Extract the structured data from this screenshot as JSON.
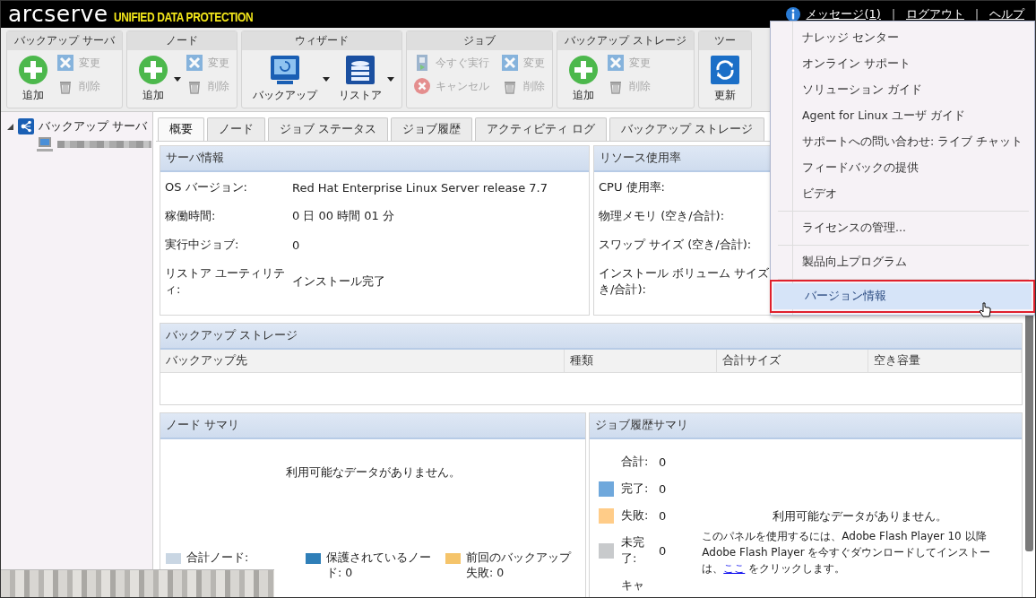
{
  "header": {
    "logo": "arcserve",
    "product": "UNIFIED DATA PROTECTION",
    "links": [
      {
        "label": "メッセージ(1)",
        "kind": "messages"
      },
      {
        "label": "ログアウト",
        "kind": "plain"
      },
      {
        "label": "ヘルプ",
        "kind": "plain"
      }
    ],
    "separator": "|"
  },
  "toolbar": [
    {
      "title": "バックアップ サーバ",
      "buttons": [
        {
          "label": "追加",
          "kind": "add",
          "disabled": false
        },
        {
          "label": "変更",
          "kind": "edit",
          "disabled": true
        },
        {
          "label": "削除",
          "kind": "delete",
          "disabled": true
        }
      ]
    },
    {
      "title": "ノード",
      "buttons": [
        {
          "label": "追加",
          "kind": "add",
          "disabled": false,
          "dropdown": true
        },
        {
          "label": "変更",
          "kind": "edit",
          "disabled": true
        },
        {
          "label": "削除",
          "kind": "delete",
          "disabled": true
        }
      ]
    },
    {
      "title": "ウィザード",
      "buttons": [
        {
          "label": "バックアップ",
          "kind": "backup",
          "disabled": false,
          "dropdown": true
        },
        {
          "label": "リストア",
          "kind": "restore",
          "disabled": false,
          "dropdown": true
        }
      ]
    },
    {
      "title": "ジョブ",
      "buttons": [
        {
          "label": "今すぐ実行",
          "kind": "run",
          "disabled": true
        },
        {
          "label": "キャンセル",
          "kind": "cancel",
          "disabled": true
        },
        {
          "label": "変更",
          "kind": "edit",
          "disabled": true
        },
        {
          "label": "削除",
          "kind": "delete",
          "disabled": true
        }
      ]
    },
    {
      "title": "バックアップ ストレージ",
      "buttons": [
        {
          "label": "追加",
          "kind": "add",
          "disabled": false
        },
        {
          "label": "変更",
          "kind": "edit",
          "disabled": true
        },
        {
          "label": "削除",
          "kind": "delete",
          "disabled": true
        }
      ]
    },
    {
      "title": "ツー",
      "buttons": [
        {
          "label": "更新",
          "kind": "refresh",
          "disabled": false
        }
      ]
    }
  ],
  "tree": [
    {
      "label": "バックアップ サーバ",
      "expanded": true,
      "children": [
        {
          "label_redacted": true
        }
      ]
    }
  ],
  "tabs": [
    {
      "label": "概要",
      "selected": true
    },
    {
      "label": "ノード",
      "selected": false
    },
    {
      "label": "ジョブ ステータス",
      "selected": false
    },
    {
      "label": "ジョブ履歴",
      "selected": false
    },
    {
      "label": "アクティビティ ログ",
      "selected": false
    },
    {
      "label": "バックアップ ストレージ",
      "selected": false
    }
  ],
  "server_info": {
    "title": "サーバ情報",
    "rows": [
      {
        "label": "OS バージョン:",
        "value": "Red Hat Enterprise Linux Server release 7.7"
      },
      {
        "label": "稼働時間:",
        "value": "0 日 00 時間 01 分"
      },
      {
        "label": "実行中ジョブ:",
        "value": "0"
      },
      {
        "label": "リストア ユーティリティ:",
        "value": "インストール完了"
      }
    ]
  },
  "resource_usage": {
    "title": "リソース使用率",
    "rows": [
      {
        "lines": [
          "CPU 使用率:"
        ]
      },
      {
        "lines": [
          "物理メモリ (空き/合計):"
        ]
      },
      {
        "lines": [
          "スワップ サイズ (空き/合計):"
        ]
      },
      {
        "lines": [
          "インストール ボリューム サイズ",
          "き/合計):"
        ]
      }
    ]
  },
  "backup_storage": {
    "title": "バックアップ ストレージ",
    "columns": [
      "バックアップ先",
      "種類",
      "合計サイズ",
      "空き容量"
    ]
  },
  "node_summary": {
    "title": "ノード サマリ",
    "message": "利用可能なデータがありません。",
    "legend": [
      {
        "label": "合計ノード:",
        "color": "#c9d6e3"
      },
      {
        "label": "保護されているノード: 0",
        "color": "#2f7fb8"
      },
      {
        "label": "前回のバックアップ失敗: 0",
        "color": "#f5c46a"
      }
    ]
  },
  "job_history": {
    "title": "ジョブ履歴サマリ",
    "legend": [
      {
        "label": "合計:",
        "value": "0"
      },
      {
        "label": "完了:",
        "value": "0",
        "color": "#6fa8dc"
      },
      {
        "label": "失敗:",
        "value": "0",
        "color": "#ffcc88"
      },
      {
        "label": "未完了:",
        "value": "0",
        "color": "#c8cacc"
      },
      {
        "label": "キャ"
      }
    ],
    "message": "利用可能なデータがありません。",
    "flash_lines": [
      "このパネルを使用するには、Adobe Flash Player 10 以降",
      "Adobe Flash Player を今すぐダウンロードしてインストー"
    ],
    "flash_tail": {
      "before": "は、",
      "link": "ここ",
      "after": " をクリックします。"
    }
  },
  "help_menu": {
    "items": [
      {
        "label": "ナレッジ センター",
        "selected": false
      },
      {
        "label": "オンライン サポート",
        "selected": false
      },
      {
        "label": "ソリューション ガイド",
        "selected": false
      },
      {
        "label": "Agent for Linux ユーザ ガイド",
        "selected": false
      },
      {
        "label": "サポートへの問い合わせ: ライブ チャット",
        "selected": false
      },
      {
        "label": "フィードバックの提供",
        "selected": false
      },
      {
        "label": "ビデオ",
        "selected": false
      },
      {
        "label": "ライセンスの管理...",
        "selected": false,
        "separator_before": true
      },
      {
        "label": "製品向上プログラム",
        "selected": false,
        "separator_before": true
      },
      {
        "label": "バージョン情報",
        "selected": true,
        "separator_before": true,
        "outlined": true
      }
    ]
  }
}
